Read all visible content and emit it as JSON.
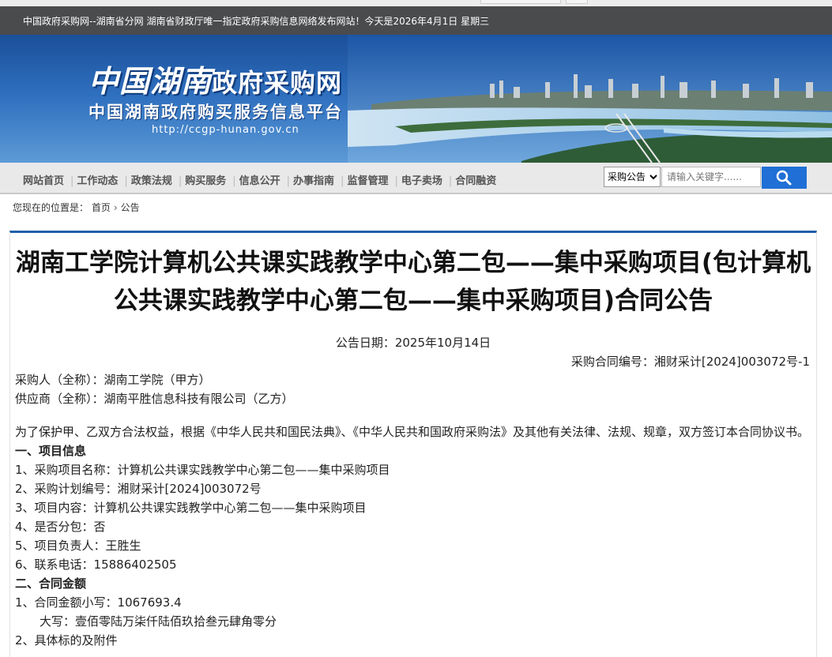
{
  "topbar": {
    "text": "中国政府采购网--湖南省分网  湖南省财政厅唯一指定政府采购信息网络发布网站！今天是2026年4月1日  星期三"
  },
  "banner": {
    "logo_script": "中国湖南",
    "logo_title": "政府采购网",
    "platform": "中国湖南政府购买服务信息平台",
    "url": "http://ccgp-hunan.gov.cn"
  },
  "nav": {
    "items": [
      "网站首页",
      "工作动态",
      "政策法规",
      "购买服务",
      "信息公开",
      "办事指南",
      "监督管理",
      "电子卖场",
      "合同融资"
    ],
    "select_value": "采购公告",
    "search_placeholder": "请输入关键字......",
    "search_icon": "search-icon"
  },
  "breadcrumb": {
    "prefix": "您现在的位置是：",
    "home": "首页",
    "current": "公告"
  },
  "article": {
    "title": "湖南工学院计算机公共课实践教学中心第二包——集中采购项目(包计算机公共课实践教学中心第二包——集中采购项目)合同公告",
    "date_line": "公告日期：2025年10月14日",
    "contract_no": "采购合同编号：湘财采计[2024]003072号-1",
    "buyer": "采购人（全称）：湖南工学院（甲方）",
    "supplier": "供应商（全称）：湖南平胜信息科技有限公司（乙方）",
    "intro": "为了保护甲、乙双方合法权益，根据《中华人民共和国民法典》、《中华人民共和国政府采购法》及其他有关法律、法规、规章，双方签订本合同协议书。",
    "section1": "一、项目信息",
    "s1_items": [
      "1、采购项目名称：计算机公共课实践教学中心第二包——集中采购项目",
      "2、采购计划编号：湘财采计[2024]003072号",
      "3、项目内容：计算机公共课实践教学中心第二包——集中采购项目",
      "4、是否分包：否",
      "5、项目负责人：王胜生",
      "6、联系电话：15886402505"
    ],
    "section2": "二、合同金额",
    "amount_small": "1、合同金额小写：1067693.4",
    "amount_big": "大写：壹佰零陆万柒仟陆佰玖拾叁元肆角零分",
    "cut_line": "2、具体标的及附件"
  }
}
